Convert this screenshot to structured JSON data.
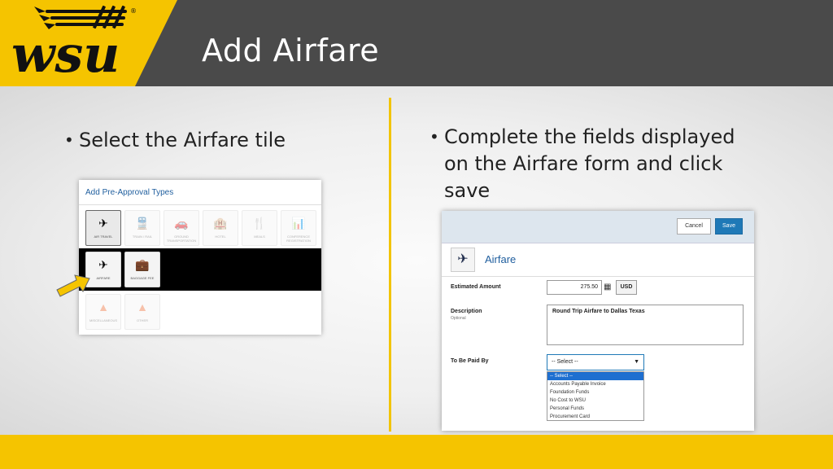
{
  "slide": {
    "title": "Add Airfare"
  },
  "logo": {
    "text": "wsu",
    "trademark": "®"
  },
  "bullets": {
    "left": "Select the Airfare tile",
    "right": "Complete the fields displayed on the Airfare form and click save",
    "marker": "•"
  },
  "colors": {
    "brand_yellow": "#f5c400",
    "header_gray": "#4a4a4a",
    "link_blue": "#1f5e9e",
    "save_blue": "#1f79b7"
  },
  "left_panel": {
    "title": "Add Pre-Approval Types",
    "tiles_row1": [
      {
        "label": "AIR TRAVEL",
        "icon": "airplane-icon"
      },
      {
        "label": "TRAIN / RAIL",
        "icon": "train-icon"
      },
      {
        "label": "GROUND TRANSPORTATION",
        "icon": "car-icon"
      },
      {
        "label": "HOTEL",
        "icon": "hotel-icon"
      },
      {
        "label": "MEALS",
        "icon": "meals-icon"
      },
      {
        "label": "CONFERENCE REGISTRATION",
        "icon": "conference-icon"
      }
    ],
    "tiles_row2": [
      {
        "label": "AIRFARE",
        "icon": "airplane-icon"
      },
      {
        "label": "BAGGAGE FEE",
        "icon": "suitcase-icon"
      }
    ],
    "tiles_row3": [
      {
        "label": "MISCELLANEOUS",
        "icon": "shapes-icon"
      },
      {
        "label": "OTHER",
        "icon": "shapes-icon"
      }
    ]
  },
  "right_panel": {
    "cancel_label": "Cancel",
    "save_label": "Save",
    "heading": "Airfare",
    "estimated_amount_label": "Estimated Amount",
    "estimated_amount_value": "275.50",
    "currency": "USD",
    "description_label": "Description",
    "description_optional": "Optional",
    "description_value": "Round Trip Airfare to Dallas Texas",
    "paid_by_label": "To Be Paid By",
    "paid_by_selected": "-- Select --",
    "paid_by_options": [
      "-- Select --",
      "Accounts Payable Invoice",
      "Foundation Funds",
      "No Cost to WSU",
      "Personal Funds",
      "Procurement Card"
    ]
  }
}
